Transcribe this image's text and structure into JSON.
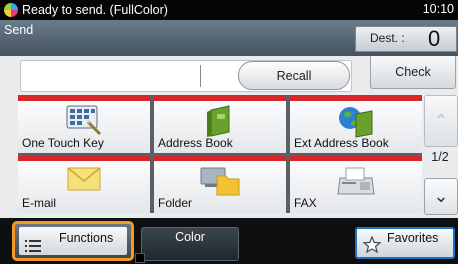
{
  "status": {
    "text": "Ready to send. (FullColor)",
    "time": "10:10"
  },
  "header": {
    "title": "Send",
    "dest_label": "Dest. :",
    "dest_count": "0"
  },
  "address_field": {
    "value": ""
  },
  "buttons": {
    "recall": "Recall",
    "check": "Check"
  },
  "keys": [
    {
      "label": "One Touch Key",
      "icon": "one-touch-key-icon"
    },
    {
      "label": "Address Book",
      "icon": "address-book-icon"
    },
    {
      "label": "Ext Address Book",
      "icon": "ext-address-book-icon"
    },
    {
      "label": "E-mail",
      "icon": "email-icon"
    },
    {
      "label": "Folder",
      "icon": "folder-icon"
    },
    {
      "label": "FAX",
      "icon": "fax-icon"
    }
  ],
  "paging": {
    "page": "1/2"
  },
  "bottom": {
    "functions": "Functions",
    "color": "Color",
    "favorites": "Favorites"
  },
  "colors": {
    "accent_red": "#d9262b",
    "highlight_orange": "#f29a24",
    "favorites_border": "#1f6fc6"
  }
}
